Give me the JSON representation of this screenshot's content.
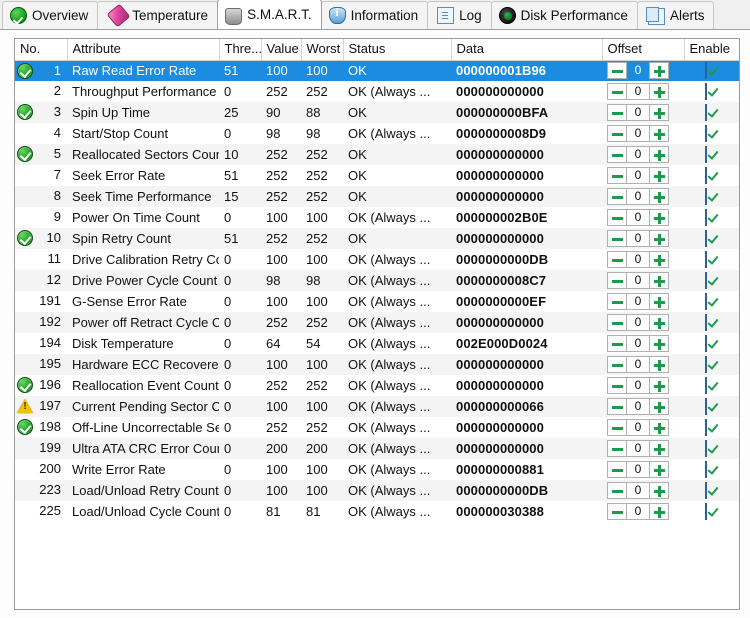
{
  "tabs": [
    {
      "label": "Overview",
      "icon": "check-circle-icon",
      "active": false
    },
    {
      "label": "Temperature",
      "icon": "thermometer-icon",
      "active": false
    },
    {
      "label": "S.M.A.R.T.",
      "icon": "smart-disk-icon",
      "active": true
    },
    {
      "label": "Information",
      "icon": "info-icon",
      "active": false
    },
    {
      "label": "Log",
      "icon": "document-icon",
      "active": false
    },
    {
      "label": "Disk Performance",
      "icon": "gauge-icon",
      "active": false
    },
    {
      "label": "Alerts",
      "icon": "copy-pages-icon",
      "active": false
    }
  ],
  "table": {
    "columns": [
      "No.",
      "Attribute",
      "Thre...",
      "Value",
      "Worst",
      "Status",
      "Data",
      "Offset",
      "Enable"
    ],
    "rows": [
      {
        "badge": "ok",
        "no": "1",
        "attribute": "Raw Read Error Rate",
        "threshold": "51",
        "value": "100",
        "worst": "100",
        "status": "OK",
        "data": "000000001B96",
        "offset": "0",
        "enable": true,
        "selected": true
      },
      {
        "badge": "none",
        "no": "2",
        "attribute": "Throughput Performance",
        "threshold": "0",
        "value": "252",
        "worst": "252",
        "status": "OK (Always ...",
        "data": "000000000000",
        "offset": "0",
        "enable": true
      },
      {
        "badge": "ok",
        "no": "3",
        "attribute": "Spin Up Time",
        "threshold": "25",
        "value": "90",
        "worst": "88",
        "status": "OK",
        "data": "000000000BFA",
        "offset": "0",
        "enable": true
      },
      {
        "badge": "none",
        "no": "4",
        "attribute": "Start/Stop Count",
        "threshold": "0",
        "value": "98",
        "worst": "98",
        "status": "OK (Always ...",
        "data": "0000000008D9",
        "offset": "0",
        "enable": true
      },
      {
        "badge": "ok",
        "no": "5",
        "attribute": "Reallocated Sectors Count",
        "threshold": "10",
        "value": "252",
        "worst": "252",
        "status": "OK",
        "data": "000000000000",
        "offset": "0",
        "enable": true
      },
      {
        "badge": "none",
        "no": "7",
        "attribute": "Seek Error Rate",
        "threshold": "51",
        "value": "252",
        "worst": "252",
        "status": "OK",
        "data": "000000000000",
        "offset": "0",
        "enable": true
      },
      {
        "badge": "none",
        "no": "8",
        "attribute": "Seek Time Performance",
        "threshold": "15",
        "value": "252",
        "worst": "252",
        "status": "OK",
        "data": "000000000000",
        "offset": "0",
        "enable": true
      },
      {
        "badge": "none",
        "no": "9",
        "attribute": "Power On Time Count",
        "threshold": "0",
        "value": "100",
        "worst": "100",
        "status": "OK (Always ...",
        "data": "000000002B0E",
        "offset": "0",
        "enable": true
      },
      {
        "badge": "ok",
        "no": "10",
        "attribute": "Spin Retry Count",
        "threshold": "51",
        "value": "252",
        "worst": "252",
        "status": "OK",
        "data": "000000000000",
        "offset": "0",
        "enable": true
      },
      {
        "badge": "none",
        "no": "11",
        "attribute": "Drive Calibration Retry Co...",
        "threshold": "0",
        "value": "100",
        "worst": "100",
        "status": "OK (Always ...",
        "data": "0000000000DB",
        "offset": "0",
        "enable": true
      },
      {
        "badge": "none",
        "no": "12",
        "attribute": "Drive Power Cycle Count",
        "threshold": "0",
        "value": "98",
        "worst": "98",
        "status": "OK (Always ...",
        "data": "0000000008C7",
        "offset": "0",
        "enable": true
      },
      {
        "badge": "none",
        "no": "191",
        "attribute": "G-Sense Error Rate",
        "threshold": "0",
        "value": "100",
        "worst": "100",
        "status": "OK (Always ...",
        "data": "0000000000EF",
        "offset": "0",
        "enable": true
      },
      {
        "badge": "none",
        "no": "192",
        "attribute": "Power off Retract Cycle C...",
        "threshold": "0",
        "value": "252",
        "worst": "252",
        "status": "OK (Always ...",
        "data": "000000000000",
        "offset": "0",
        "enable": true
      },
      {
        "badge": "none",
        "no": "194",
        "attribute": "Disk Temperature",
        "threshold": "0",
        "value": "64",
        "worst": "54",
        "status": "OK (Always ...",
        "data": "002E000D0024",
        "offset": "0",
        "enable": true
      },
      {
        "badge": "none",
        "no": "195",
        "attribute": "Hardware ECC Recovered",
        "threshold": "0",
        "value": "100",
        "worst": "100",
        "status": "OK (Always ...",
        "data": "000000000000",
        "offset": "0",
        "enable": true
      },
      {
        "badge": "ok",
        "no": "196",
        "attribute": "Reallocation Event Count",
        "threshold": "0",
        "value": "252",
        "worst": "252",
        "status": "OK (Always ...",
        "data": "000000000000",
        "offset": "0",
        "enable": true
      },
      {
        "badge": "warn",
        "no": "197",
        "attribute": "Current Pending Sector C...",
        "threshold": "0",
        "value": "100",
        "worst": "100",
        "status": "OK (Always ...",
        "data": "000000000066",
        "offset": "0",
        "enable": true
      },
      {
        "badge": "ok",
        "no": "198",
        "attribute": "Off-Line Uncorrectable Se...",
        "threshold": "0",
        "value": "252",
        "worst": "252",
        "status": "OK (Always ...",
        "data": "000000000000",
        "offset": "0",
        "enable": true
      },
      {
        "badge": "none",
        "no": "199",
        "attribute": "Ultra ATA CRC Error Count",
        "threshold": "0",
        "value": "200",
        "worst": "200",
        "status": "OK (Always ...",
        "data": "000000000000",
        "offset": "0",
        "enable": true
      },
      {
        "badge": "none",
        "no": "200",
        "attribute": "Write Error Rate",
        "threshold": "0",
        "value": "100",
        "worst": "100",
        "status": "OK (Always ...",
        "data": "000000000881",
        "offset": "0",
        "enable": true
      },
      {
        "badge": "none",
        "no": "223",
        "attribute": "Load/Unload Retry Count",
        "threshold": "0",
        "value": "100",
        "worst": "100",
        "status": "OK (Always ...",
        "data": "0000000000DB",
        "offset": "0",
        "enable": true
      },
      {
        "badge": "none",
        "no": "225",
        "attribute": "Load/Unload Cycle Count",
        "threshold": "0",
        "value": "81",
        "worst": "81",
        "status": "OK (Always ...",
        "data": "000000030388",
        "offset": "0",
        "enable": true
      }
    ]
  },
  "colors": {
    "selection": "#1c8ce0",
    "ok_badge": "#109414",
    "warn_badge": "#f2c200",
    "spinner_green": "#1d9a4e"
  }
}
